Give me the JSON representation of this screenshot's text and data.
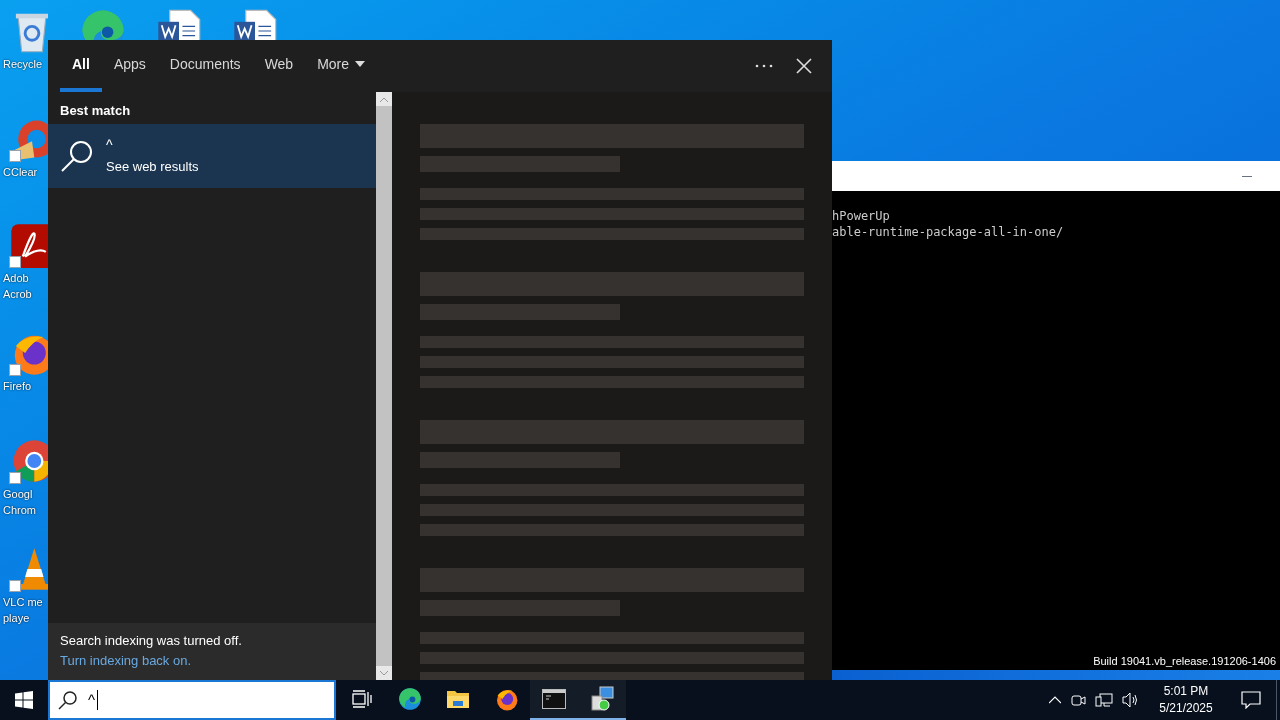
{
  "desktop_icons": [
    {
      "kind": "recycle",
      "label": "Recycle"
    },
    {
      "kind": "ccleaner",
      "label": "CClear"
    },
    {
      "kind": "acrobat",
      "label": "Adob\nAcrob"
    },
    {
      "kind": "firefox",
      "label": "Firefo"
    },
    {
      "kind": "chrome",
      "label": "Googl\nChrom"
    },
    {
      "kind": "vlc",
      "label": "VLC me\nplaye"
    }
  ],
  "desktop_top_icons": [
    {
      "kind": "edge"
    },
    {
      "kind": "word"
    },
    {
      "kind": "word"
    }
  ],
  "console_window": {
    "lines": [
      "hPowerUp",
      "able-runtime-package-all-in-one/"
    ]
  },
  "desktop_build_text": "Build 19041.vb_release.191206-1406",
  "search_panel": {
    "tabs": [
      {
        "label": "All",
        "selected": true
      },
      {
        "label": "Apps",
        "selected": false
      },
      {
        "label": "Documents",
        "selected": false
      },
      {
        "label": "Web",
        "selected": false
      },
      {
        "label": "More",
        "selected": false
      }
    ],
    "section_heading": "Best match",
    "best_match": {
      "title": "^",
      "subtitle": "See web results",
      "selected": true
    },
    "notice": {
      "text": "Search indexing was turned off.",
      "link": "Turn indexing back on."
    }
  },
  "taskbar": {
    "search": {
      "value": "^"
    },
    "apps": [
      {
        "kind": "task-view",
        "running": false
      },
      {
        "kind": "edge",
        "running": false
      },
      {
        "kind": "explorer",
        "running": false
      },
      {
        "kind": "firefox",
        "running": false
      },
      {
        "kind": "console",
        "running": true
      },
      {
        "kind": "installer",
        "running": true
      }
    ],
    "clock": {
      "time": "5:01 PM",
      "date": "5/21/2025"
    }
  }
}
